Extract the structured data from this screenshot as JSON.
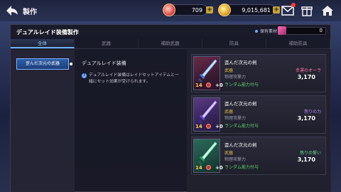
{
  "header": {
    "title": "製作",
    "gem_count": "709",
    "gold_count": "9,015,681"
  },
  "panel": {
    "title": "デュアルレイド装備製作",
    "material_label": "保有素材",
    "material_count": "0"
  },
  "tabs": [
    {
      "label": "全体",
      "active": true
    },
    {
      "label": "武器",
      "active": false
    },
    {
      "label": "補助武器",
      "active": false
    },
    {
      "label": "防具",
      "active": false
    },
    {
      "label": "補助防具",
      "active": false
    }
  ],
  "filter": {
    "selected": "歪んだ次元の武器"
  },
  "description": {
    "title": "デュアルレイド装備",
    "info": "デュアルレイド装備はレイドセットアイテムと一緒にセット効果が受けられます。"
  },
  "items": [
    {
      "name": "歪んだ次元の剣",
      "category": "武器",
      "stat": "物理攻撃力",
      "extra": "ランダム能力付与",
      "tag": "幸運のオーラ",
      "power": "3,170",
      "level": "14",
      "plus": "+0"
    },
    {
      "name": "歪んだ次元の剣",
      "category": "武器",
      "stat": "物理攻撃力",
      "extra": "ランダム能力付与",
      "tag": "怒りの力",
      "power": "3,170",
      "level": "14",
      "plus": "+0"
    },
    {
      "name": "歪んだ次元の剣",
      "category": "武器",
      "stat": "物理攻撃力",
      "extra": "ランダム能力付与",
      "tag": "怒りの誓い",
      "power": "3,170",
      "level": "14",
      "plus": "+0"
    }
  ],
  "colors": {
    "accent": "#6fb0ff",
    "gold_text": "#e4c24a",
    "green_text": "#5fd26a"
  }
}
